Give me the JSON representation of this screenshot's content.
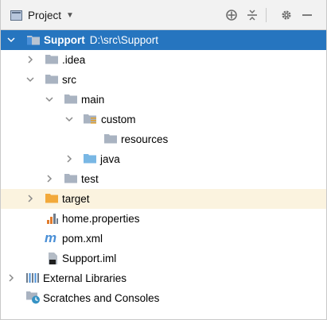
{
  "header": {
    "view_label": "Project",
    "buttons": [
      "locate-icon",
      "collapse-all-icon",
      "settings-icon",
      "hide-icon"
    ]
  },
  "tree": [
    {
      "label": "Support",
      "path": "D:\\src\\Support",
      "icon": "module-folder-icon",
      "expanded": true,
      "selected": true
    },
    {
      "label": ".idea",
      "icon": "folder-icon",
      "expanded": false
    },
    {
      "label": "src",
      "icon": "folder-icon",
      "expanded": true
    },
    {
      "label": "main",
      "icon": "folder-icon",
      "expanded": true
    },
    {
      "label": "custom",
      "icon": "resource-root-folder-icon",
      "expanded": true
    },
    {
      "label": "resources",
      "icon": "folder-icon"
    },
    {
      "label": "java",
      "icon": "source-folder-icon",
      "expanded": false
    },
    {
      "label": "test",
      "icon": "folder-icon",
      "expanded": false
    },
    {
      "label": "target",
      "icon": "excluded-folder-icon",
      "expanded": false
    },
    {
      "label": "home.properties",
      "icon": "properties-file-icon"
    },
    {
      "label": "pom.xml",
      "icon": "maven-file-icon"
    },
    {
      "label": "Support.iml",
      "icon": "iml-file-icon"
    },
    {
      "label": "External Libraries",
      "icon": "libraries-icon",
      "expanded": false
    },
    {
      "label": "Scratches and Consoles",
      "icon": "scratches-icon"
    }
  ]
}
